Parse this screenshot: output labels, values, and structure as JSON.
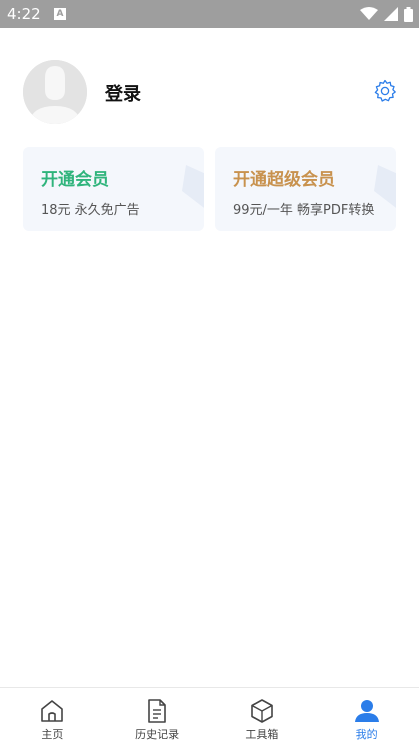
{
  "status_bar": {
    "time": "4:22",
    "notification_letter": "A"
  },
  "profile": {
    "login_label": "登录"
  },
  "cards": {
    "vip": {
      "title": "开通会员",
      "subtitle": "18元 永久免广告",
      "title_color": "#2fb47c"
    },
    "svip": {
      "title": "开通超级会员",
      "subtitle": "99元/一年 畅享PDF转换",
      "title_color": "#c8924e"
    }
  },
  "tabs": [
    {
      "label": "主页",
      "icon": "home-icon",
      "active": false
    },
    {
      "label": "历史记录",
      "icon": "document-icon",
      "active": false
    },
    {
      "label": "工具箱",
      "icon": "box-icon",
      "active": false
    },
    {
      "label": "我的",
      "icon": "person-icon",
      "active": true
    }
  ],
  "colors": {
    "accent": "#2b7de9",
    "status_bar": "#9e9e9e",
    "card_bg": "#f4f7fc"
  }
}
